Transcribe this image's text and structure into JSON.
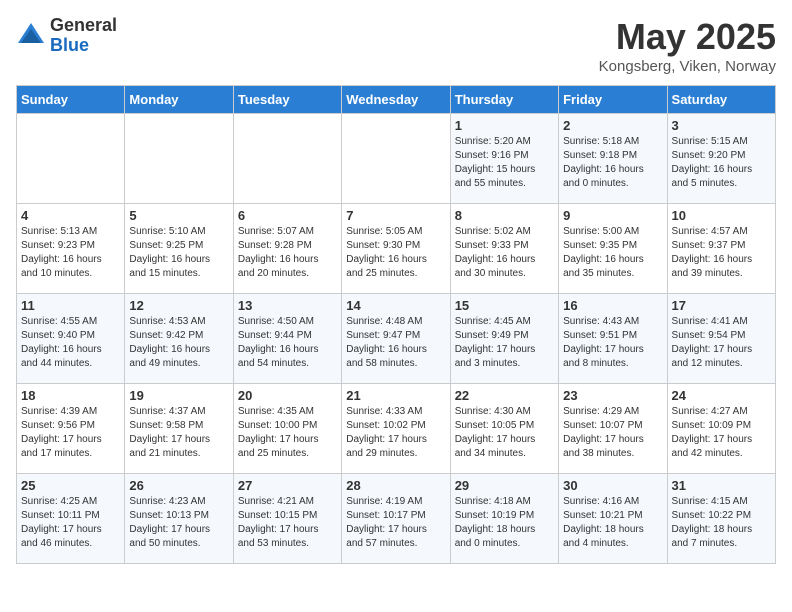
{
  "header": {
    "logo": {
      "general": "General",
      "blue": "Blue"
    },
    "title": "May 2025",
    "subtitle": "Kongsberg, Viken, Norway"
  },
  "days_of_week": [
    "Sunday",
    "Monday",
    "Tuesday",
    "Wednesday",
    "Thursday",
    "Friday",
    "Saturday"
  ],
  "weeks": [
    [
      {
        "day": "",
        "info": ""
      },
      {
        "day": "",
        "info": ""
      },
      {
        "day": "",
        "info": ""
      },
      {
        "day": "",
        "info": ""
      },
      {
        "day": "1",
        "info": "Sunrise: 5:20 AM\nSunset: 9:16 PM\nDaylight: 15 hours\nand 55 minutes."
      },
      {
        "day": "2",
        "info": "Sunrise: 5:18 AM\nSunset: 9:18 PM\nDaylight: 16 hours\nand 0 minutes."
      },
      {
        "day": "3",
        "info": "Sunrise: 5:15 AM\nSunset: 9:20 PM\nDaylight: 16 hours\nand 5 minutes."
      }
    ],
    [
      {
        "day": "4",
        "info": "Sunrise: 5:13 AM\nSunset: 9:23 PM\nDaylight: 16 hours\nand 10 minutes."
      },
      {
        "day": "5",
        "info": "Sunrise: 5:10 AM\nSunset: 9:25 PM\nDaylight: 16 hours\nand 15 minutes."
      },
      {
        "day": "6",
        "info": "Sunrise: 5:07 AM\nSunset: 9:28 PM\nDaylight: 16 hours\nand 20 minutes."
      },
      {
        "day": "7",
        "info": "Sunrise: 5:05 AM\nSunset: 9:30 PM\nDaylight: 16 hours\nand 25 minutes."
      },
      {
        "day": "8",
        "info": "Sunrise: 5:02 AM\nSunset: 9:33 PM\nDaylight: 16 hours\nand 30 minutes."
      },
      {
        "day": "9",
        "info": "Sunrise: 5:00 AM\nSunset: 9:35 PM\nDaylight: 16 hours\nand 35 minutes."
      },
      {
        "day": "10",
        "info": "Sunrise: 4:57 AM\nSunset: 9:37 PM\nDaylight: 16 hours\nand 39 minutes."
      }
    ],
    [
      {
        "day": "11",
        "info": "Sunrise: 4:55 AM\nSunset: 9:40 PM\nDaylight: 16 hours\nand 44 minutes."
      },
      {
        "day": "12",
        "info": "Sunrise: 4:53 AM\nSunset: 9:42 PM\nDaylight: 16 hours\nand 49 minutes."
      },
      {
        "day": "13",
        "info": "Sunrise: 4:50 AM\nSunset: 9:44 PM\nDaylight: 16 hours\nand 54 minutes."
      },
      {
        "day": "14",
        "info": "Sunrise: 4:48 AM\nSunset: 9:47 PM\nDaylight: 16 hours\nand 58 minutes."
      },
      {
        "day": "15",
        "info": "Sunrise: 4:45 AM\nSunset: 9:49 PM\nDaylight: 17 hours\nand 3 minutes."
      },
      {
        "day": "16",
        "info": "Sunrise: 4:43 AM\nSunset: 9:51 PM\nDaylight: 17 hours\nand 8 minutes."
      },
      {
        "day": "17",
        "info": "Sunrise: 4:41 AM\nSunset: 9:54 PM\nDaylight: 17 hours\nand 12 minutes."
      }
    ],
    [
      {
        "day": "18",
        "info": "Sunrise: 4:39 AM\nSunset: 9:56 PM\nDaylight: 17 hours\nand 17 minutes."
      },
      {
        "day": "19",
        "info": "Sunrise: 4:37 AM\nSunset: 9:58 PM\nDaylight: 17 hours\nand 21 minutes."
      },
      {
        "day": "20",
        "info": "Sunrise: 4:35 AM\nSunset: 10:00 PM\nDaylight: 17 hours\nand 25 minutes."
      },
      {
        "day": "21",
        "info": "Sunrise: 4:33 AM\nSunset: 10:02 PM\nDaylight: 17 hours\nand 29 minutes."
      },
      {
        "day": "22",
        "info": "Sunrise: 4:30 AM\nSunset: 10:05 PM\nDaylight: 17 hours\nand 34 minutes."
      },
      {
        "day": "23",
        "info": "Sunrise: 4:29 AM\nSunset: 10:07 PM\nDaylight: 17 hours\nand 38 minutes."
      },
      {
        "day": "24",
        "info": "Sunrise: 4:27 AM\nSunset: 10:09 PM\nDaylight: 17 hours\nand 42 minutes."
      }
    ],
    [
      {
        "day": "25",
        "info": "Sunrise: 4:25 AM\nSunset: 10:11 PM\nDaylight: 17 hours\nand 46 minutes."
      },
      {
        "day": "26",
        "info": "Sunrise: 4:23 AM\nSunset: 10:13 PM\nDaylight: 17 hours\nand 50 minutes."
      },
      {
        "day": "27",
        "info": "Sunrise: 4:21 AM\nSunset: 10:15 PM\nDaylight: 17 hours\nand 53 minutes."
      },
      {
        "day": "28",
        "info": "Sunrise: 4:19 AM\nSunset: 10:17 PM\nDaylight: 17 hours\nand 57 minutes."
      },
      {
        "day": "29",
        "info": "Sunrise: 4:18 AM\nSunset: 10:19 PM\nDaylight: 18 hours\nand 0 minutes."
      },
      {
        "day": "30",
        "info": "Sunrise: 4:16 AM\nSunset: 10:21 PM\nDaylight: 18 hours\nand 4 minutes."
      },
      {
        "day": "31",
        "info": "Sunrise: 4:15 AM\nSunset: 10:22 PM\nDaylight: 18 hours\nand 7 minutes."
      }
    ]
  ]
}
